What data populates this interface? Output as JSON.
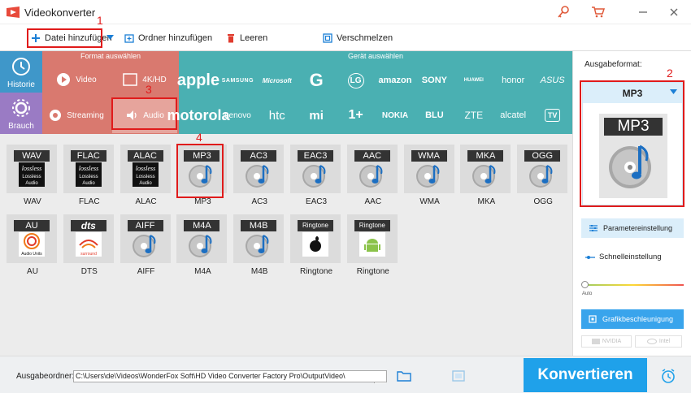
{
  "window": {
    "title": "Videokonverter"
  },
  "toolbar": {
    "add_file": "Datei hinzufügen",
    "add_folder": "Ordner hinzufügen",
    "clear": "Leeren",
    "merge": "Verschmelzen"
  },
  "annotations": [
    "1",
    "2",
    "3",
    "4"
  ],
  "left_nav": {
    "history": "Historie",
    "toolbox": "Brauch"
  },
  "format_section": {
    "header": "Format auswählen",
    "buttons": [
      "Video",
      "4K/HD",
      "Streaming",
      "Audio"
    ]
  },
  "device_section": {
    "header": "Gerät auswählen",
    "brands_row1": [
      "apple",
      "SAMSUNG",
      "Microsoft",
      "G",
      "LG",
      "amazon",
      "SONY",
      "HUAWEI",
      "honor",
      "ASUS"
    ],
    "brands_row2": [
      "motorola",
      "Lenovo",
      "htc",
      "mi",
      "1+",
      "NOKIA",
      "BLU",
      "ZTE",
      "alcatel",
      "TV"
    ]
  },
  "formats": [
    {
      "badge": "WAV",
      "label": "WAV",
      "art": "lossless"
    },
    {
      "badge": "FLAC",
      "label": "FLAC",
      "art": "lossless"
    },
    {
      "badge": "ALAC",
      "label": "ALAC",
      "art": "lossless"
    },
    {
      "badge": "MP3",
      "label": "MP3",
      "art": "disc"
    },
    {
      "badge": "AC3",
      "label": "AC3",
      "art": "disc"
    },
    {
      "badge": "EAC3",
      "label": "EAC3",
      "art": "disc"
    },
    {
      "badge": "AAC",
      "label": "AAC",
      "art": "disc"
    },
    {
      "badge": "WMA",
      "label": "WMA",
      "art": "disc"
    },
    {
      "badge": "MKA",
      "label": "MKA",
      "art": "disc"
    },
    {
      "badge": "OGG",
      "label": "OGG",
      "art": "disc"
    },
    {
      "badge": "AU",
      "label": "AU",
      "art": "audiounits"
    },
    {
      "badge": "dts",
      "label": "DTS",
      "art": "surround"
    },
    {
      "badge": "AIFF",
      "label": "AIFF",
      "art": "disc"
    },
    {
      "badge": "M4A",
      "label": "M4A",
      "art": "disc"
    },
    {
      "badge": "M4B",
      "label": "M4B",
      "art": "disc"
    },
    {
      "badge": "Ringtone",
      "label": "Ringtone",
      "art": "apple"
    },
    {
      "badge": "Ringtone",
      "label": "Ringtone",
      "art": "android"
    }
  ],
  "art_text": {
    "lossless": "lossless",
    "lossless_sub": "Lossless\nAudio",
    "audiounits": "Audio Units",
    "surround": "surround"
  },
  "right_panel": {
    "output_format_label": "Ausgabeformat:",
    "selected_format": "MP3",
    "big_badge": "MP3",
    "param_button": "Parametereinstellung",
    "quick_setting": "Schnelleinstellung",
    "slider_label": "Auto",
    "gpu_button": "Grafikbeschleunigung",
    "nvidia": "NVIDIA",
    "intel": "Intel"
  },
  "bottom": {
    "output_folder_label": "Ausgabeordner:",
    "output_path": "C:\\Users\\de\\Videos\\WonderFox Soft\\HD Video Converter Factory Pro\\OutputVideo\\",
    "convert_button": "Konvertieren"
  },
  "colors": {
    "accent": "#1fa1ea",
    "format": "#d9796f",
    "device": "#4ab0b2",
    "highlight": "#e01b1b"
  }
}
